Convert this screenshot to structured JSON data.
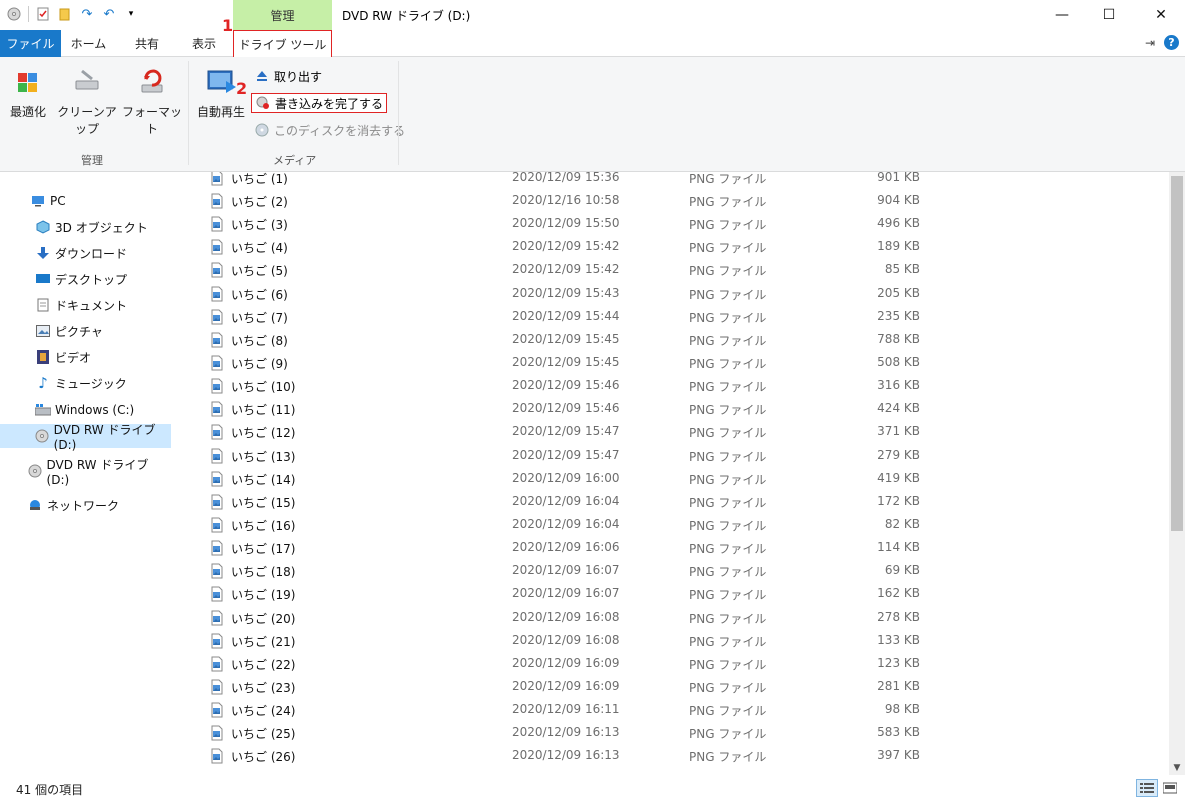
{
  "window": {
    "title": "DVD RW ドライブ (D:)",
    "context_tab_group": "管理",
    "minimize": "—",
    "maximize": "☐",
    "close": "✕"
  },
  "ribbon_tabs": [
    "ファイル",
    "ホーム",
    "共有",
    "表示",
    "ドライブ ツール"
  ],
  "callouts": [
    "1",
    "2"
  ],
  "ribbon": {
    "manage_group": {
      "label": "管理",
      "buttons": [
        "最適化",
        "クリーンアップ",
        "フォーマット"
      ]
    },
    "media_group": {
      "label": "メディア",
      "autoplay": "自動再生",
      "eject": "取り出す",
      "finish_burning": "書き込みを完了する",
      "erase_disc": "このディスクを消去する"
    }
  },
  "nav": {
    "items": [
      {
        "label": "PC",
        "icon": "pc-icon"
      },
      {
        "label": "3D オブジェクト",
        "icon": "3d-objects-icon"
      },
      {
        "label": "ダウンロード",
        "icon": "download-icon"
      },
      {
        "label": "デスクトップ",
        "icon": "desktop-icon"
      },
      {
        "label": "ドキュメント",
        "icon": "document-icon"
      },
      {
        "label": "ピクチャ",
        "icon": "pictures-icon"
      },
      {
        "label": "ビデオ",
        "icon": "video-icon"
      },
      {
        "label": "ミュージック",
        "icon": "music-icon"
      },
      {
        "label": "Windows (C:)",
        "icon": "drive-icon"
      },
      {
        "label": "DVD RW ドライブ (D:)",
        "icon": "dvd-icon",
        "selected": true
      },
      {
        "label": "DVD RW ドライブ (D:)",
        "icon": "dvd-icon"
      },
      {
        "label": "ネットワーク",
        "icon": "network-icon"
      }
    ]
  },
  "files": [
    {
      "name": "いちご (1)",
      "date": "2020/12/09 15:36",
      "type": "PNG ファイル",
      "size": "901 KB"
    },
    {
      "name": "いちご (2)",
      "date": "2020/12/16 10:58",
      "type": "PNG ファイル",
      "size": "904 KB"
    },
    {
      "name": "いちご (3)",
      "date": "2020/12/09 15:50",
      "type": "PNG ファイル",
      "size": "496 KB"
    },
    {
      "name": "いちご (4)",
      "date": "2020/12/09 15:42",
      "type": "PNG ファイル",
      "size": "189 KB"
    },
    {
      "name": "いちご (5)",
      "date": "2020/12/09 15:42",
      "type": "PNG ファイル",
      "size": "85 KB"
    },
    {
      "name": "いちご (6)",
      "date": "2020/12/09 15:43",
      "type": "PNG ファイル",
      "size": "205 KB"
    },
    {
      "name": "いちご (7)",
      "date": "2020/12/09 15:44",
      "type": "PNG ファイル",
      "size": "235 KB"
    },
    {
      "name": "いちご (8)",
      "date": "2020/12/09 15:45",
      "type": "PNG ファイル",
      "size": "788 KB"
    },
    {
      "name": "いちご (9)",
      "date": "2020/12/09 15:45",
      "type": "PNG ファイル",
      "size": "508 KB"
    },
    {
      "name": "いちご (10)",
      "date": "2020/12/09 15:46",
      "type": "PNG ファイル",
      "size": "316 KB"
    },
    {
      "name": "いちご (11)",
      "date": "2020/12/09 15:46",
      "type": "PNG ファイル",
      "size": "424 KB"
    },
    {
      "name": "いちご (12)",
      "date": "2020/12/09 15:47",
      "type": "PNG ファイル",
      "size": "371 KB"
    },
    {
      "name": "いちご (13)",
      "date": "2020/12/09 15:47",
      "type": "PNG ファイル",
      "size": "279 KB"
    },
    {
      "name": "いちご (14)",
      "date": "2020/12/09 16:00",
      "type": "PNG ファイル",
      "size": "419 KB"
    },
    {
      "name": "いちご (15)",
      "date": "2020/12/09 16:04",
      "type": "PNG ファイル",
      "size": "172 KB"
    },
    {
      "name": "いちご (16)",
      "date": "2020/12/09 16:04",
      "type": "PNG ファイル",
      "size": "82 KB"
    },
    {
      "name": "いちご (17)",
      "date": "2020/12/09 16:06",
      "type": "PNG ファイル",
      "size": "114 KB"
    },
    {
      "name": "いちご (18)",
      "date": "2020/12/09 16:07",
      "type": "PNG ファイル",
      "size": "69 KB"
    },
    {
      "name": "いちご (19)",
      "date": "2020/12/09 16:07",
      "type": "PNG ファイル",
      "size": "162 KB"
    },
    {
      "name": "いちご (20)",
      "date": "2020/12/09 16:08",
      "type": "PNG ファイル",
      "size": "278 KB"
    },
    {
      "name": "いちご (21)",
      "date": "2020/12/09 16:08",
      "type": "PNG ファイル",
      "size": "133 KB"
    },
    {
      "name": "いちご (22)",
      "date": "2020/12/09 16:09",
      "type": "PNG ファイル",
      "size": "123 KB"
    },
    {
      "name": "いちご (23)",
      "date": "2020/12/09 16:09",
      "type": "PNG ファイル",
      "size": "281 KB"
    },
    {
      "name": "いちご (24)",
      "date": "2020/12/09 16:11",
      "type": "PNG ファイル",
      "size": "98 KB"
    },
    {
      "name": "いちご (25)",
      "date": "2020/12/09 16:13",
      "type": "PNG ファイル",
      "size": "583 KB"
    },
    {
      "name": "いちご (26)",
      "date": "2020/12/09 16:13",
      "type": "PNG ファイル",
      "size": "397 KB"
    }
  ],
  "status": {
    "item_count": "41 個の項目"
  },
  "colors": {
    "accent": "#1979ca",
    "context_tab": "#c6efa7",
    "callout_red": "#e02424",
    "selection": "#cce8ff"
  }
}
